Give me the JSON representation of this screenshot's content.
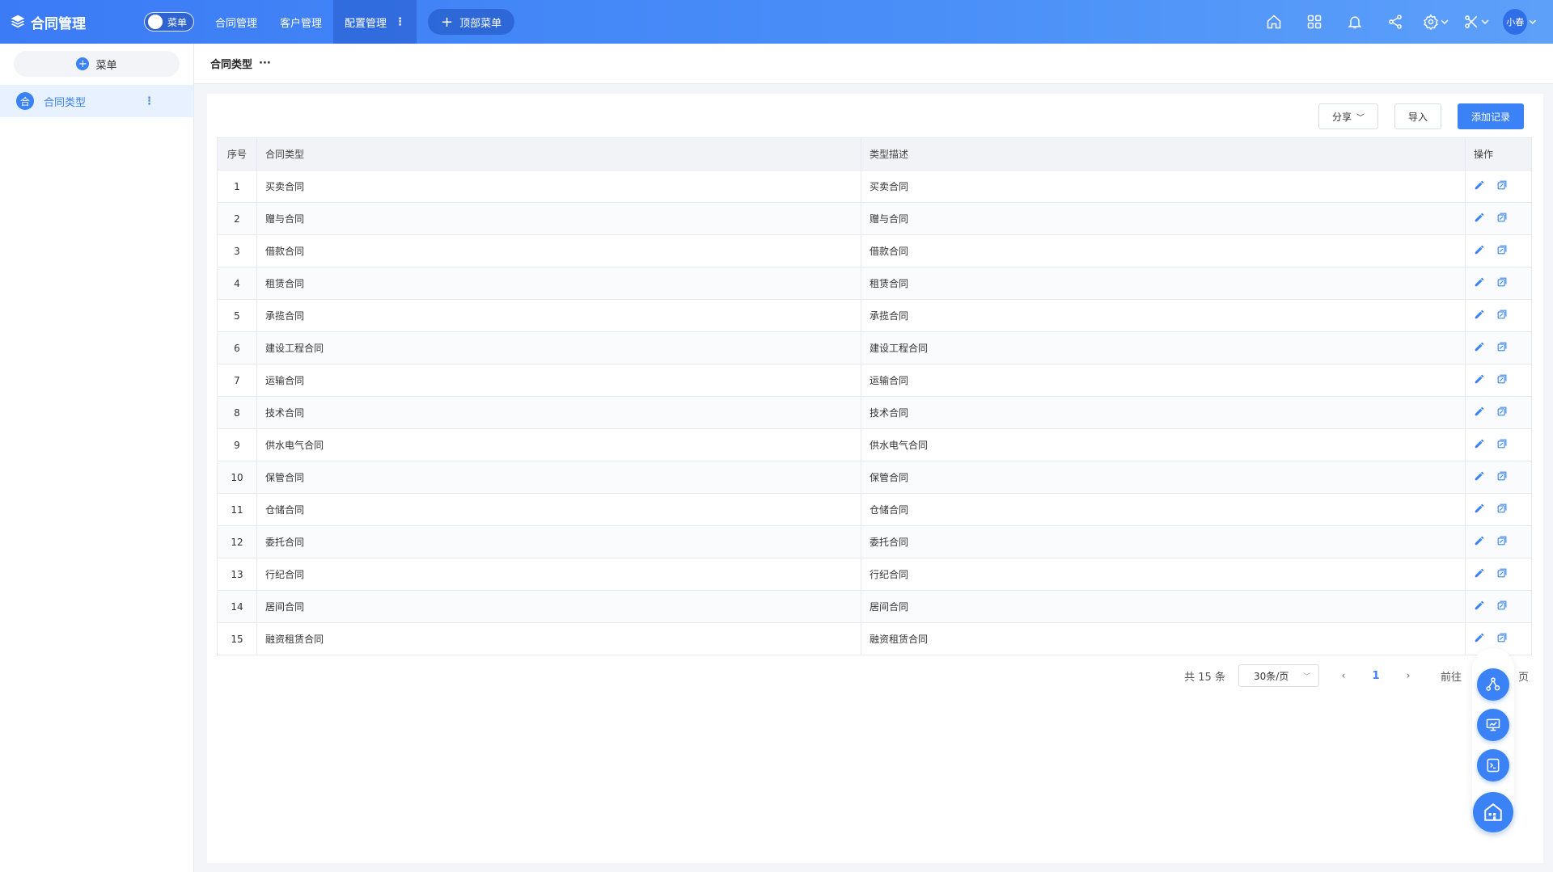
{
  "app": {
    "title": "合同管理",
    "menu_toggle_label": "菜单"
  },
  "topnav": {
    "items": [
      {
        "label": "合同管理"
      },
      {
        "label": "客户管理"
      },
      {
        "label": "配置管理"
      }
    ],
    "add_label": "顶部菜单",
    "user": "小春"
  },
  "sidebar": {
    "menu_button_label": "菜单",
    "items": [
      {
        "icon_text": "合",
        "label": "合同类型"
      }
    ]
  },
  "breadcrumb": {
    "title": "合同类型"
  },
  "toolbar": {
    "share_label": "分享",
    "import_label": "导入",
    "add_label": "添加记录"
  },
  "table": {
    "headers": [
      "序号",
      "合同类型",
      "类型描述",
      "操作"
    ],
    "rows": [
      {
        "no": "1",
        "type": "买卖合同",
        "desc": "买卖合同"
      },
      {
        "no": "2",
        "type": "赠与合同",
        "desc": "赠与合同"
      },
      {
        "no": "3",
        "type": "借款合同",
        "desc": "借款合同"
      },
      {
        "no": "4",
        "type": "租赁合同",
        "desc": "租赁合同"
      },
      {
        "no": "5",
        "type": "承揽合同",
        "desc": "承揽合同"
      },
      {
        "no": "6",
        "type": "建设工程合同",
        "desc": "建设工程合同"
      },
      {
        "no": "7",
        "type": "运输合同",
        "desc": "运输合同"
      },
      {
        "no": "8",
        "type": "技术合同",
        "desc": "技术合同"
      },
      {
        "no": "9",
        "type": "供水电气合同",
        "desc": "供水电气合同"
      },
      {
        "no": "10",
        "type": "保管合同",
        "desc": "保管合同"
      },
      {
        "no": "11",
        "type": "仓储合同",
        "desc": "仓储合同"
      },
      {
        "no": "12",
        "type": "委托合同",
        "desc": "委托合同"
      },
      {
        "no": "13",
        "type": "行纪合同",
        "desc": "行纪合同"
      },
      {
        "no": "14",
        "type": "居间合同",
        "desc": "居间合同"
      },
      {
        "no": "15",
        "type": "融资租赁合同",
        "desc": "融资租赁合同"
      }
    ]
  },
  "pagination": {
    "total_text": "共 15 条",
    "page_size": "30条/页",
    "current_page": "1",
    "goto_label": "前往",
    "page_suffix": "页"
  },
  "colors": {
    "accent": "#3b82f6",
    "topbar_start": "#3b7bf6",
    "topbar_end": "#5da0fa"
  }
}
